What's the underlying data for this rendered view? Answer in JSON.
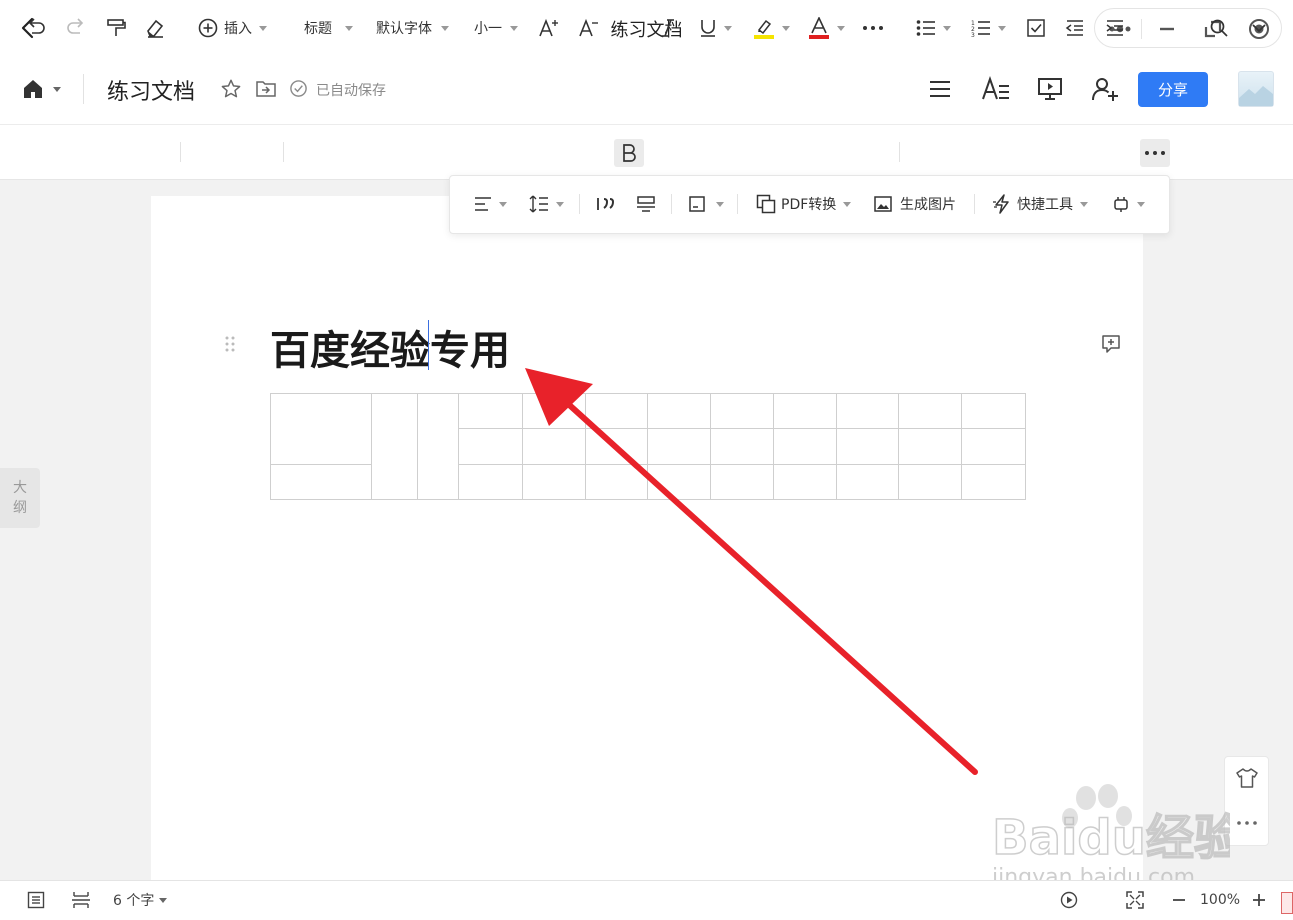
{
  "window": {
    "title": "练习文档"
  },
  "doc": {
    "title": "练习文档",
    "autosave": "已自动保存",
    "share_label": "分享"
  },
  "toolbar": {
    "insert": "插入",
    "style": "标题",
    "font": "默认字体",
    "size": "小一"
  },
  "popup": {
    "pdf": "PDF转换",
    "image": "生成图片",
    "quicktools": "快捷工具"
  },
  "content": {
    "heading": "百度经验专用"
  },
  "outline": {
    "label_1": "大",
    "label_2": "纲"
  },
  "status": {
    "word_count": "6 个字",
    "zoom": "100%"
  },
  "colors": {
    "accent": "#2f7bf5",
    "annotation": "#e8222a",
    "highlight": "#f5e400",
    "font_color": "#e02020"
  },
  "watermark": {
    "brand": "Baidu经验",
    "url": "jingyan.baidu.com"
  }
}
